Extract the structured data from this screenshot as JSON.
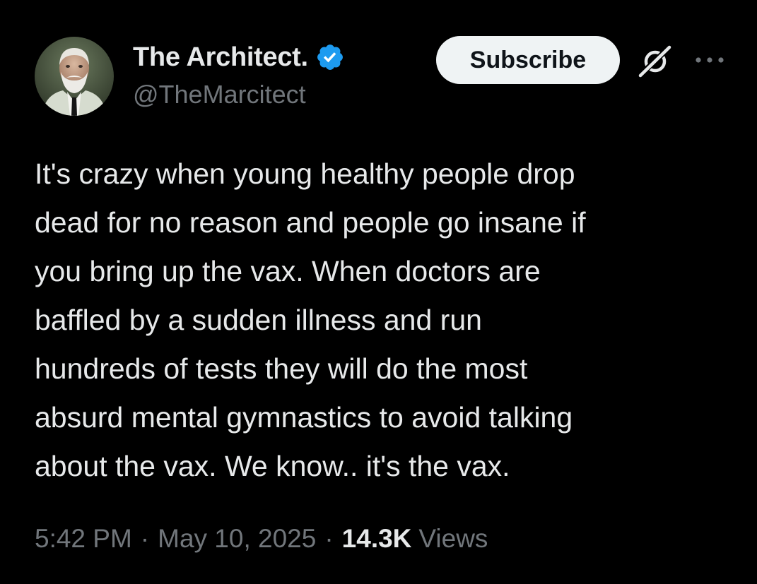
{
  "author": {
    "display_name": "The Architect.",
    "handle": "@TheMarcitect",
    "verified": true,
    "verified_color": "#1d9bf0"
  },
  "actions": {
    "subscribe_label": "Subscribe",
    "grok_icon": "grok-icon",
    "more_icon": "more-horizontal-icon"
  },
  "tweet": {
    "lines": [
      "It's crazy when young healthy people drop",
      "dead for no reason and people go insane if",
      "you bring up the vax. When doctors are",
      "baffled by a sudden illness and run",
      "hundreds of tests they will do the most",
      "absurd mental gymnastics to avoid talking",
      "about the vax. We know.. it's the vax."
    ]
  },
  "meta": {
    "time": "5:42 PM",
    "separator": "·",
    "date": "May 10, 2025",
    "views_count": "14.3K",
    "views_label": "Views"
  },
  "colors": {
    "background": "#000000",
    "text_primary": "#e7e9ea",
    "text_secondary": "#71767b",
    "subscribe_bg": "#eff3f4",
    "subscribe_text": "#0f1419"
  }
}
